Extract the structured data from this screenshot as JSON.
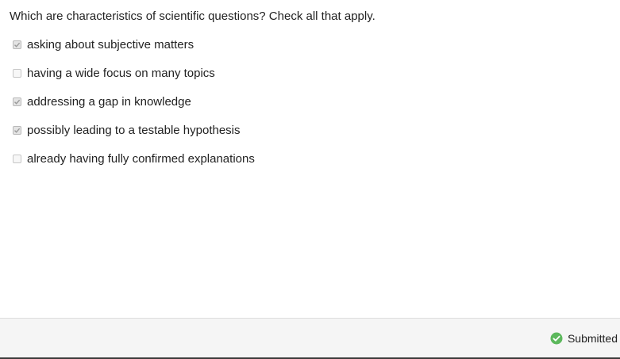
{
  "question": {
    "text": "Which are characteristics of scientific questions? Check all that apply."
  },
  "options": [
    {
      "label": "asking about subjective matters",
      "checked": true
    },
    {
      "label": "having a wide focus on many topics",
      "checked": false
    },
    {
      "label": "addressing a gap in knowledge",
      "checked": true
    },
    {
      "label": "possibly leading to a testable hypothesis",
      "checked": true
    },
    {
      "label": "already having fully confirmed explanations",
      "checked": false
    }
  ],
  "footer": {
    "status_text": "Submitted",
    "status_icon": "check-circle-icon",
    "status_color": "#5cb85c"
  }
}
